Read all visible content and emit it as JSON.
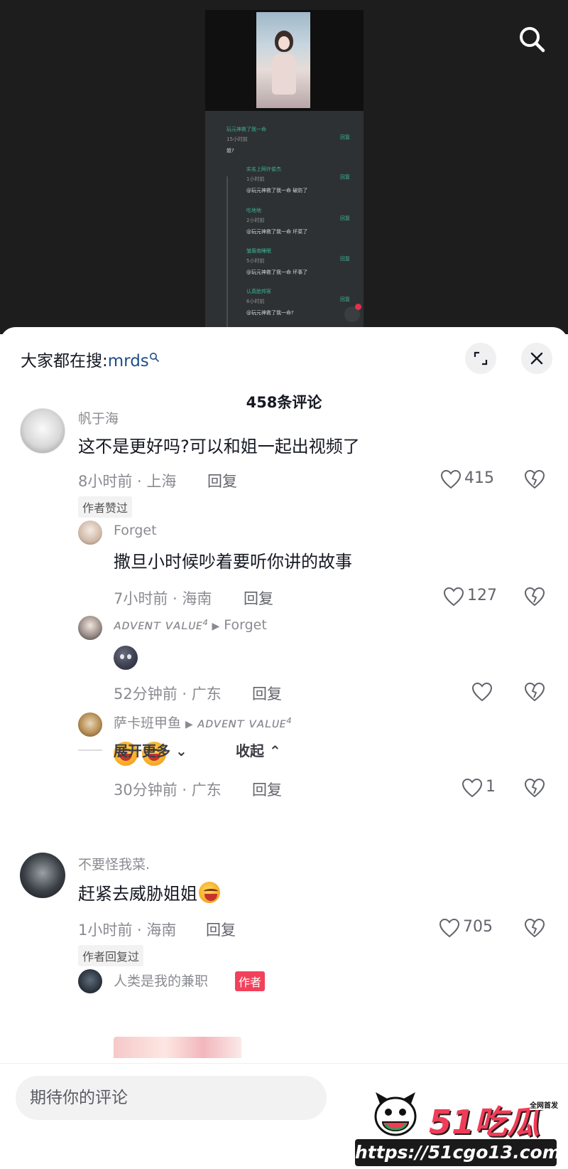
{
  "screenshot": {
    "rows": [
      {
        "name": "玩元神救了我一命",
        "time": "15小时前",
        "text": "姐?",
        "reply": "回复"
      },
      {
        "name": "实名上网许俊杰",
        "time": "1小时前",
        "text": "@玩元神救了我一命 破防了",
        "reply": "回复"
      },
      {
        "name": "吃地地",
        "time": "2小时前",
        "text": "@玩元神救了我一命 坏菜了",
        "reply": "回复"
      },
      {
        "name": "皱眉南睡眠",
        "time": "5小时前",
        "text": "@玩元神救了我一命 坏事了",
        "reply": "回复"
      },
      {
        "name": "认真脸邦客",
        "time": "6小时前",
        "text": "@玩元神救了我一命?",
        "reply": "回复"
      }
    ]
  },
  "header": {
    "search_prefix": "大家都在搜:",
    "search_keyword": "mrds",
    "comment_count": "458条评论"
  },
  "comments": [
    {
      "user": "帆于海",
      "text": "这不是更好吗?可以和姐一起出视频了",
      "meta": "8小时前 · 上海",
      "reply": "回复",
      "likes": "415",
      "tag": "作者赞过",
      "replies": [
        {
          "user": "Forget",
          "text": "撒旦小时候吵着要听你讲的故事",
          "meta": "7小时前 · 海南",
          "reply": "回复",
          "likes": "127"
        },
        {
          "user": "ᴀᴅᴠᴇɴᴛ ᴠᴀʟᴜᴇ⁴",
          "reply_to": "Forget",
          "meta": "52分钟前 · 广东",
          "reply": "回复",
          "likes": ""
        },
        {
          "user": "萨卡班甲鱼",
          "reply_to": "ᴀᴅᴠᴇɴᴛ ᴠᴀʟᴜᴇ⁴",
          "meta": "30分钟前 · 广东",
          "reply": "回复",
          "likes": "1"
        }
      ],
      "expand_label": "展开更多",
      "collapse_label": "收起"
    },
    {
      "user": "不要怪我菜.",
      "text": "赶紧去威胁姐姐",
      "meta": "1小时前 · 海南",
      "reply": "回复",
      "likes": "705",
      "tag": "作者回复过",
      "replies": [
        {
          "user": "人类是我的兼职",
          "badge": "作者"
        }
      ]
    }
  ],
  "input": {
    "placeholder": "期待你的评论"
  },
  "watermark": {
    "title": "51吃瓜",
    "sub": "全网首发",
    "url": "https://51cgo13.com"
  },
  "colors": {
    "accent": "#f2415b",
    "keyword": "#1f4d8a",
    "link_green": "#39b39a"
  }
}
